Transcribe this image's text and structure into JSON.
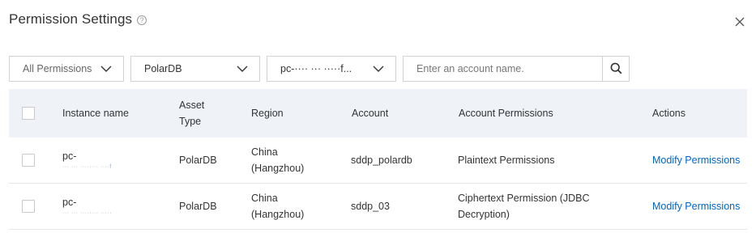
{
  "dialog": {
    "title": "Permission Settings",
    "help_icon": "question-circle-icon",
    "close_icon": "close-icon"
  },
  "filters": {
    "permission_select": "All Permissions",
    "db_type_select": "PolarDB",
    "instance_select": "pc-···· ··· ·····f...",
    "search_placeholder": "Enter an account name.",
    "search_icon": "search-icon"
  },
  "table": {
    "columns": {
      "instance_name": "Instance name",
      "asset_type_line1": "Asset",
      "asset_type_line2": "Type",
      "region": "Region",
      "account": "Account",
      "account_permissions": "Account Permissions",
      "actions": "Actions"
    },
    "rows": [
      {
        "instance_line1": "pc-",
        "instance_line2": "··· ··· ········ ····f",
        "asset_type": "PolarDB",
        "region_line1": "China",
        "region_line2": "(Hangzhou)",
        "account": "sddp_polardb",
        "permission_line1": "Plaintext Permissions",
        "permission_line2": "",
        "action": "Modify Permissions"
      },
      {
        "instance_line1": "pc-",
        "instance_line2": "··· ··· ········ ·····",
        "asset_type": "PolarDB",
        "region_line1": "China",
        "region_line2": "(Hangzhou)",
        "account": "sddp_03",
        "permission_line1": "Ciphertext Permission (JDBC",
        "permission_line2": "Decryption)",
        "action": "Modify Permissions"
      }
    ]
  },
  "colors": {
    "header_bg": "#eff3f8",
    "link": "#0064c8",
    "border": "#d1d1d1"
  }
}
